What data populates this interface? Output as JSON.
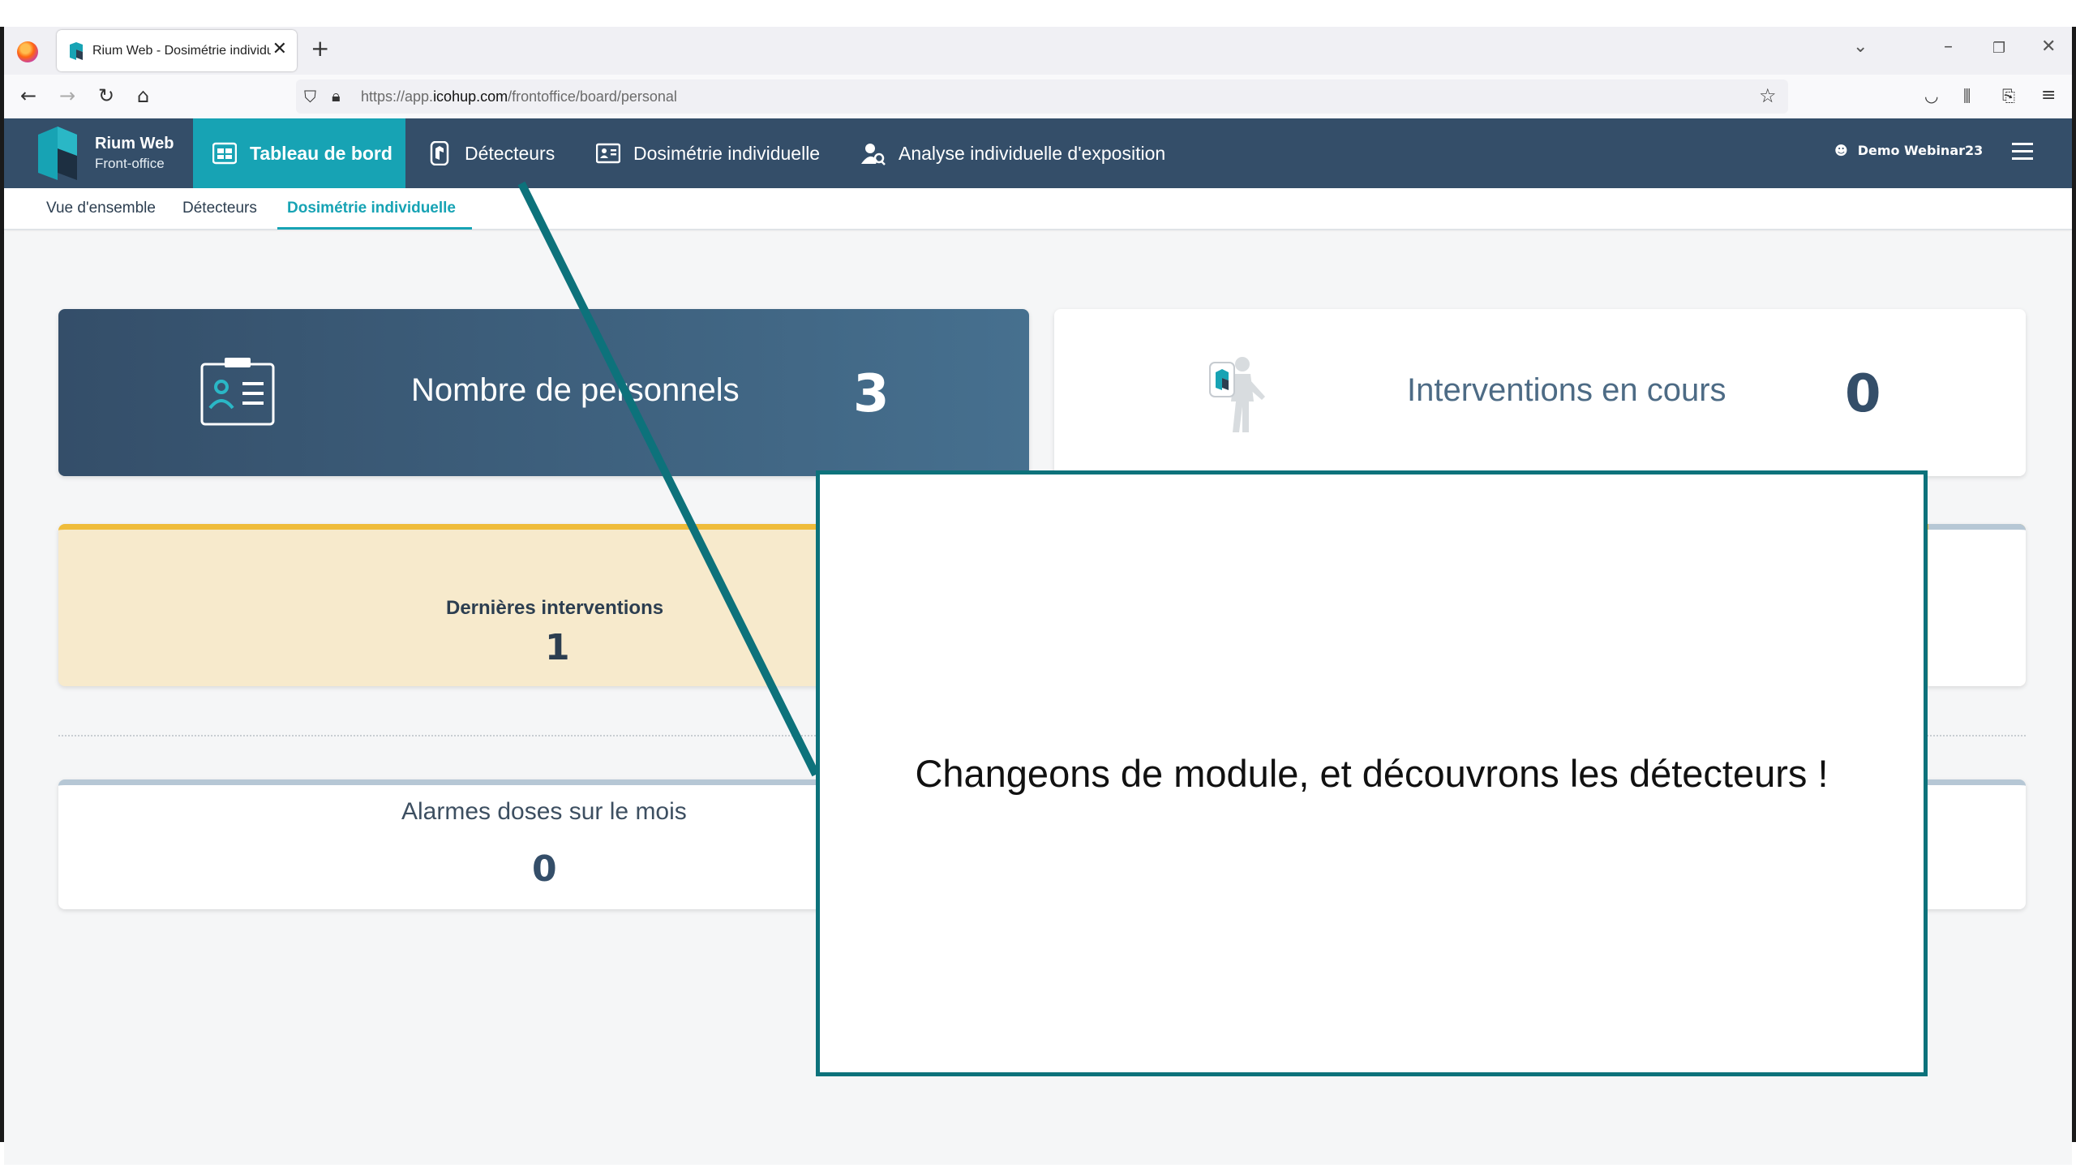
{
  "browser": {
    "tab_title": "Rium Web - Dosimétrie individuelle",
    "url_prefix": "https://app.",
    "url_domain": "icohup.com",
    "url_path": "/frontoffice/board/personal"
  },
  "app": {
    "brand_name": "Rium Web",
    "brand_sub": "Front-office",
    "menu": [
      {
        "label": "Tableau de bord",
        "icon": "dashboard-icon",
        "active": true
      },
      {
        "label": "Détecteurs",
        "icon": "detector-icon",
        "active": false
      },
      {
        "label": "Dosimétrie individuelle",
        "icon": "badge-icon",
        "active": false
      },
      {
        "label": "Analyse individuelle d'exposition",
        "icon": "person-search-icon",
        "active": false
      }
    ],
    "user": "Demo Webinar23",
    "subnav": [
      {
        "label": "Vue d'ensemble",
        "active": false
      },
      {
        "label": "Détecteurs",
        "active": false
      },
      {
        "label": "Dosimétrie individuelle",
        "active": true
      }
    ]
  },
  "dashboard": {
    "personnel_label": "Nombre de personnels",
    "personnel_value": "3",
    "interventions_label": "Interventions en cours",
    "interventions_value": "0",
    "last_interventions_label": "Dernières interventions",
    "last_interventions_value": "1",
    "alarms_label": "Alarmes doses sur le mois",
    "alarms_value": "0"
  },
  "tutorial": {
    "message": "Changeons de module, et découvrons les détecteurs !"
  },
  "colors": {
    "header": "#344e69",
    "accent": "#17a3b4",
    "tutorial_border": "#0d727b",
    "warning_band": "#efbc3b"
  }
}
